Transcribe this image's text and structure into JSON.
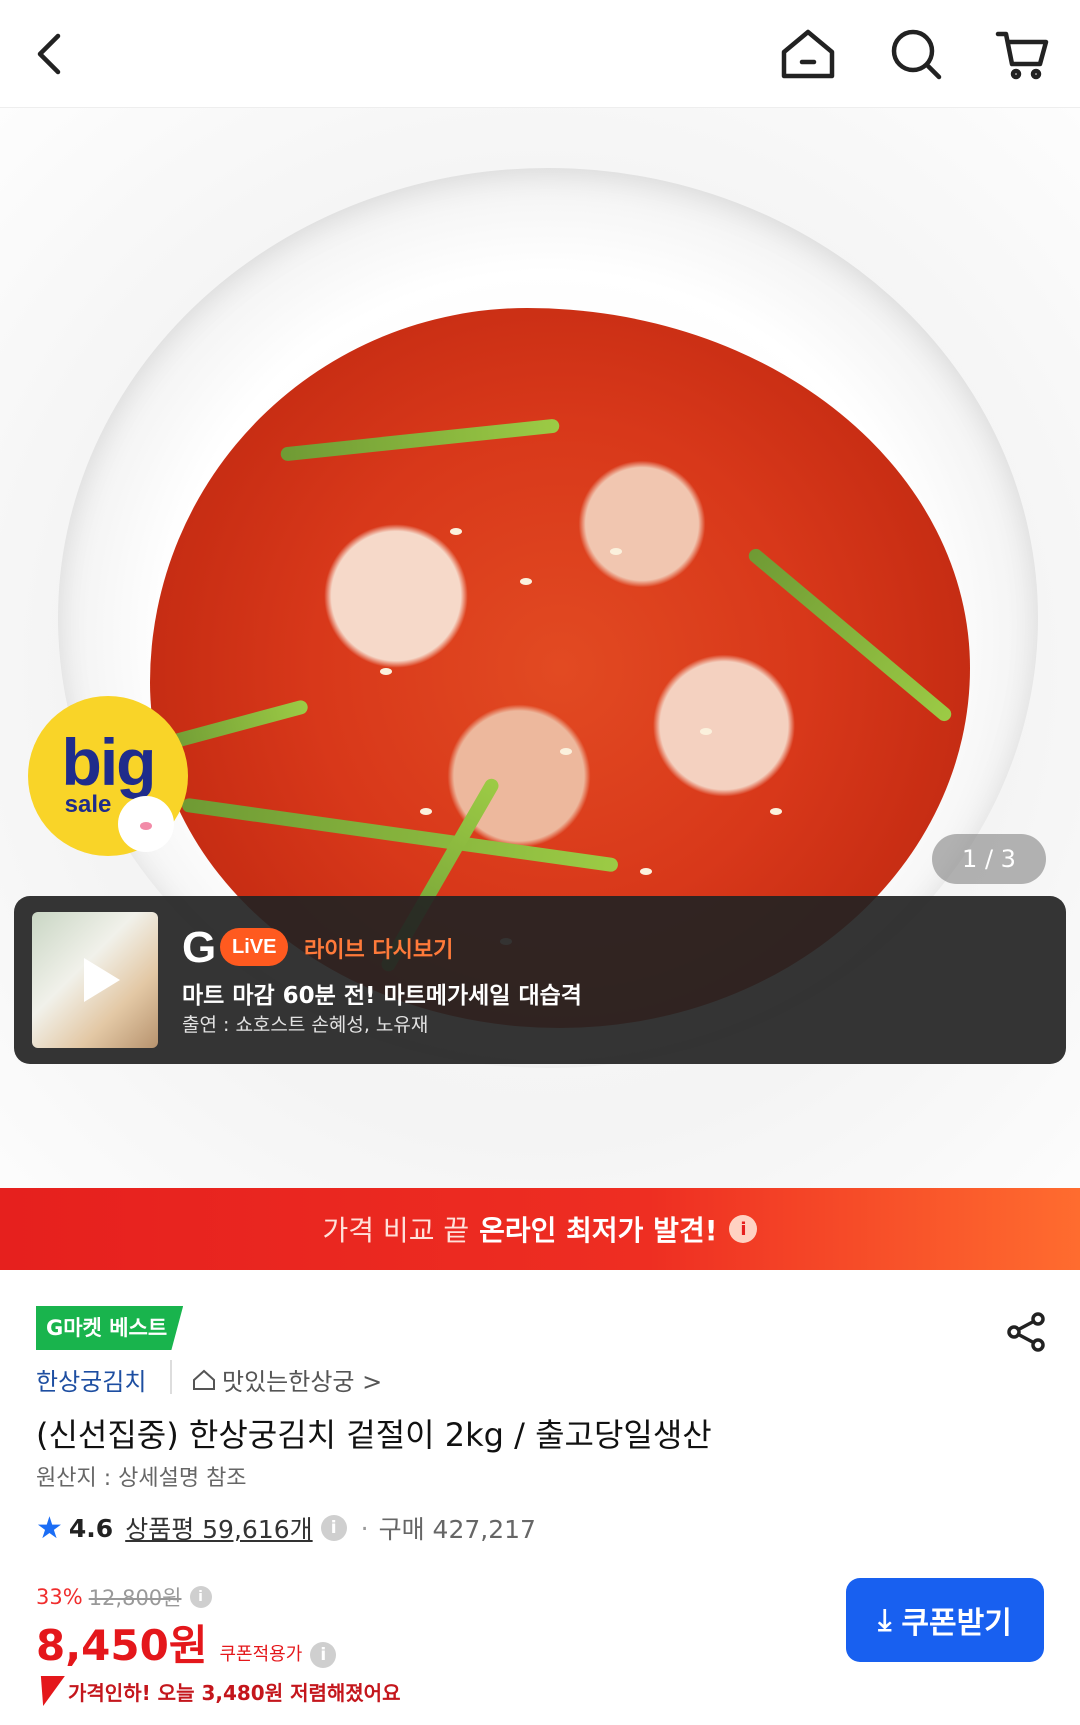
{
  "header": {
    "back_icon": "chevron-left-icon",
    "home_icon": "home-icon",
    "search_icon": "search-icon",
    "cart_icon": "cart-icon"
  },
  "hero": {
    "badge": {
      "big": "big",
      "sale": "sale"
    },
    "image_counter": "1 / 3",
    "live": {
      "logo": "G",
      "pill": "LiVE",
      "replay_label": "라이브 다시보기",
      "title": "마트 마감 60분 전! 마트메가세일 대습격",
      "cast": "출연 : 쇼호스트 손혜성, 노유재"
    }
  },
  "banner": {
    "prefix": "가격 비교 끝",
    "highlight": "온라인 최저가 발견!",
    "info": "i"
  },
  "product": {
    "best_badge": "G마켓 베스트",
    "brand": "한상궁김치",
    "store": "맛있는한상궁 >",
    "title": "(신선집중) 한상궁김치 겉절이 2kg / 출고당일생산",
    "origin": "원산지 : 상세설명 참조",
    "rating": "4.6",
    "reviews": "상품평 59,616개",
    "purchases": "구매 427,217",
    "discount_pct": "33%",
    "original_price": "12,800원",
    "price": "8,450원",
    "price_label": "쿠폰적용가",
    "price_drop": "가격인하! 오늘 3,480원 저렴해졌어요",
    "coupon_button": "쿠폰받기",
    "info": "i"
  },
  "colors": {
    "brand_blue": "#1860f0",
    "price_red": "#e4171b",
    "best_green": "#19b44d",
    "banner_red": "#e6201e"
  }
}
